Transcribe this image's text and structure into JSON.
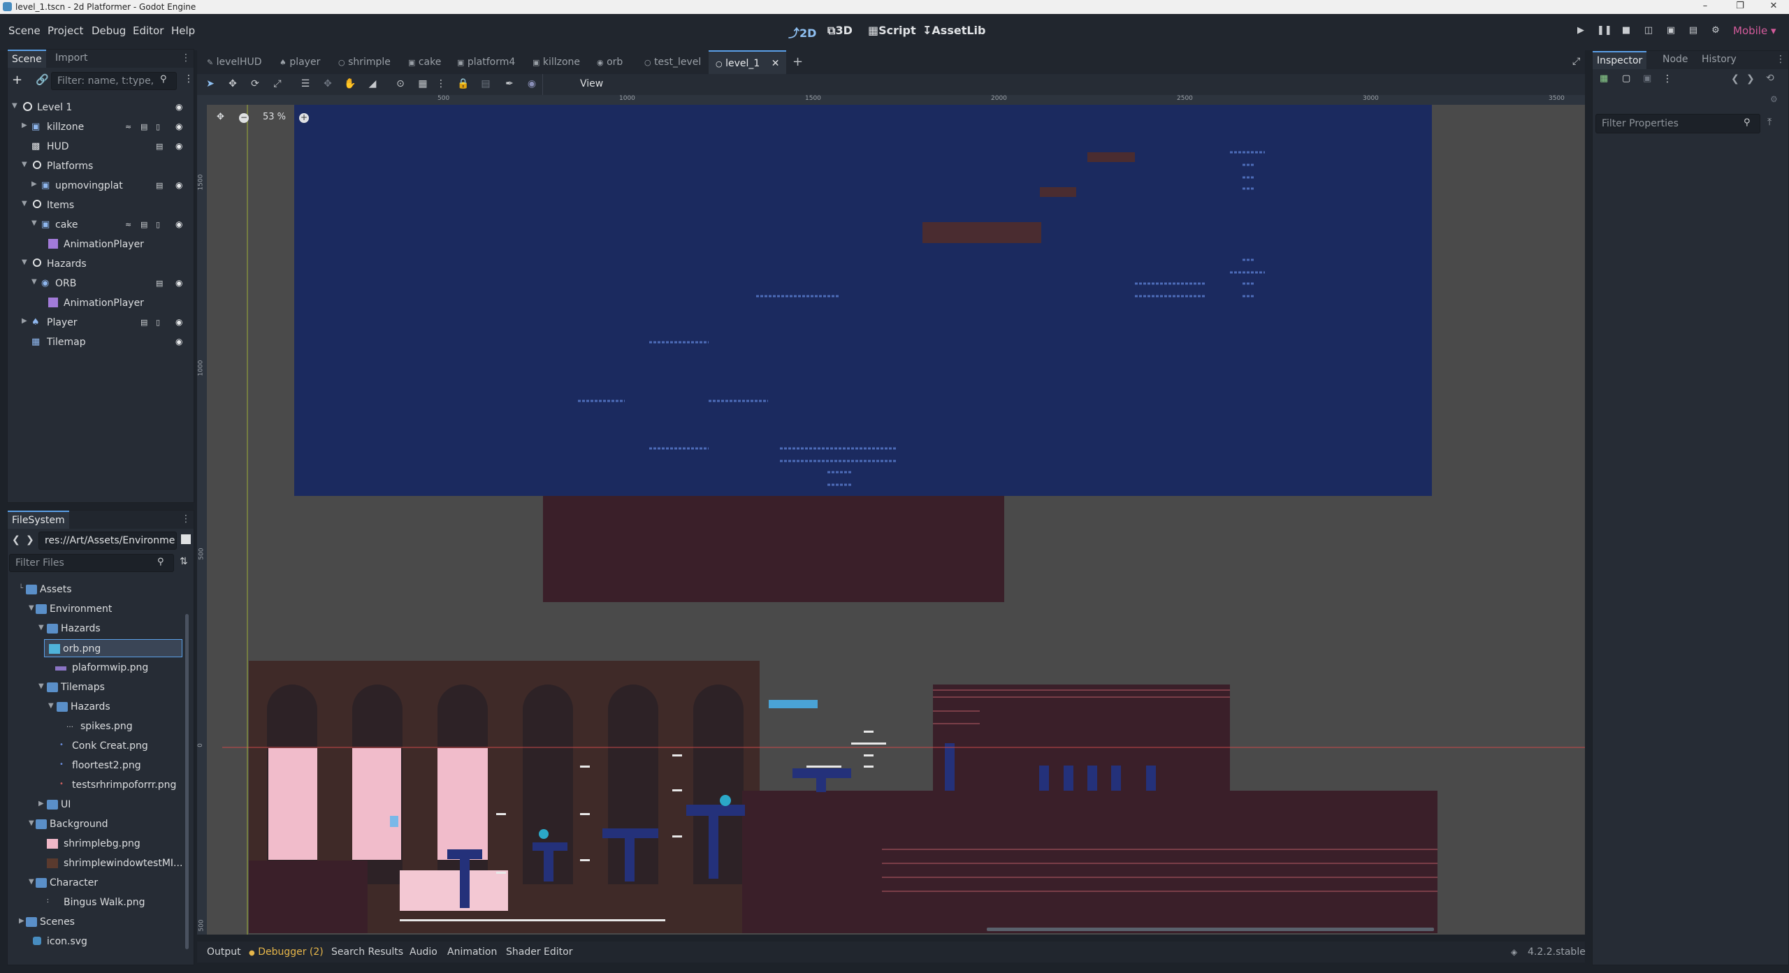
{
  "window": {
    "title": "level_1.tscn - 2d Platformer - Godot Engine"
  },
  "menubar": {
    "items": [
      "Scene",
      "Project",
      "Debug",
      "Editor",
      "Help"
    ],
    "main_tabs": [
      "2D",
      "3D",
      "Script",
      "AssetLib"
    ],
    "renderer": "Mobile"
  },
  "scene_dock": {
    "tabs": [
      "Scene",
      "Import"
    ],
    "filter_placeholder": "Filter: name, t:type,",
    "tree": [
      {
        "label": "Level 1"
      },
      {
        "label": "killzone"
      },
      {
        "label": "HUD"
      },
      {
        "label": "Platforms"
      },
      {
        "label": "upmovingplat"
      },
      {
        "label": "Items"
      },
      {
        "label": "cake"
      },
      {
        "label": "AnimationPlayer"
      },
      {
        "label": "Hazards"
      },
      {
        "label": "ORB"
      },
      {
        "label": "AnimationPlayer"
      },
      {
        "label": "Player"
      },
      {
        "label": "Tilemap"
      }
    ]
  },
  "filesystem_dock": {
    "tab": "FileSystem",
    "path": "res://Art/Assets/Environme",
    "filter_placeholder": "Filter Files",
    "items": [
      {
        "label": "Assets"
      },
      {
        "label": "Environment"
      },
      {
        "label": "Hazards"
      },
      {
        "label": "orb.png"
      },
      {
        "label": "plaformwip.png"
      },
      {
        "label": "Tilemaps"
      },
      {
        "label": "Hazards"
      },
      {
        "label": "spikes.png"
      },
      {
        "label": "Conk Creat.png"
      },
      {
        "label": "floortest2.png"
      },
      {
        "label": "testsrhrimpoforrr.png"
      },
      {
        "label": "UI"
      },
      {
        "label": "Background"
      },
      {
        "label": "shrimplebg.png"
      },
      {
        "label": "shrimplewindowtestMI..."
      },
      {
        "label": "Character"
      },
      {
        "label": "Bingus Walk.png"
      },
      {
        "label": "Scenes"
      },
      {
        "label": "icon.svg"
      }
    ]
  },
  "scene_tabs": [
    "levelHUD",
    "player",
    "shrimple",
    "cake",
    "platform4",
    "killzone",
    "orb",
    "test_level",
    "level_1"
  ],
  "viewport": {
    "view_menu": "View",
    "zoom": "53 %",
    "ruler_h": [
      "500",
      "1000",
      "1500",
      "2000",
      "2500",
      "3000",
      "3500"
    ],
    "ruler_v": [
      "1500",
      "1000",
      "500",
      "0",
      "500"
    ]
  },
  "bottom_tabs": [
    "Output",
    "Debugger (2)",
    "Search Results",
    "Audio",
    "Animation",
    "Shader Editor"
  ],
  "version": "4.2.2.stable",
  "inspector": {
    "tabs": [
      "Inspector",
      "Node",
      "History"
    ],
    "filter_placeholder": "Filter Properties"
  },
  "colors": {
    "accent": "#5ba0e8",
    "debugger_dot": "#e6b64a",
    "renderer": "#d35b9b",
    "sky": "#1b2a5f",
    "wall": "#3f2a28",
    "dark_block": "#3a1f29"
  }
}
